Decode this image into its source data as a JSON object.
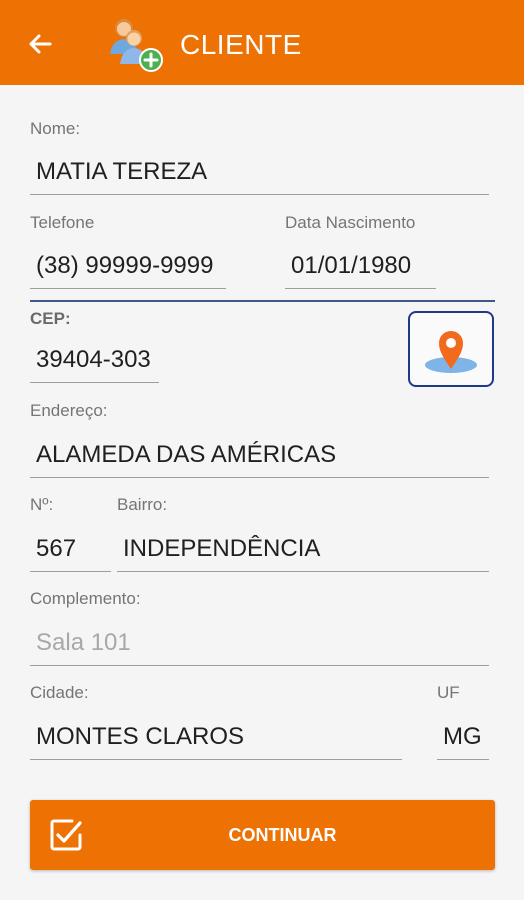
{
  "colors": {
    "accent": "#ee7203",
    "map_border": "#1f3a8a",
    "divider": "#3b5a86"
  },
  "header": {
    "title": "CLIENTE",
    "back_icon": "arrow-left-icon",
    "app_icon": "add-client-icon"
  },
  "form": {
    "nome": {
      "label": "Nome:",
      "value": "MATIA TEREZA"
    },
    "telefone": {
      "label": "Telefone",
      "value": "(38) 99999-9999"
    },
    "data_nascimento": {
      "label": "Data Nascimento",
      "value": "01/01/1980"
    },
    "cep": {
      "label": "CEP:",
      "value": "39404-303"
    },
    "endereco": {
      "label": "Endereço:",
      "value": "ALAMEDA DAS AMÉRICAS"
    },
    "numero": {
      "label": "Nº:",
      "value": "567"
    },
    "bairro": {
      "label": "Bairro:",
      "value": "INDEPENDÊNCIA"
    },
    "complemento": {
      "label": "Complemento:",
      "placeholder": "Sala 101"
    },
    "cidade": {
      "label": "Cidade:",
      "value": "MONTES CLAROS"
    },
    "uf": {
      "label": "UF",
      "value": "MG"
    }
  },
  "actions": {
    "map_icon": "map-pin-icon",
    "continue_label": "CONTINUAR",
    "continue_icon": "checkbox-edit-icon"
  }
}
